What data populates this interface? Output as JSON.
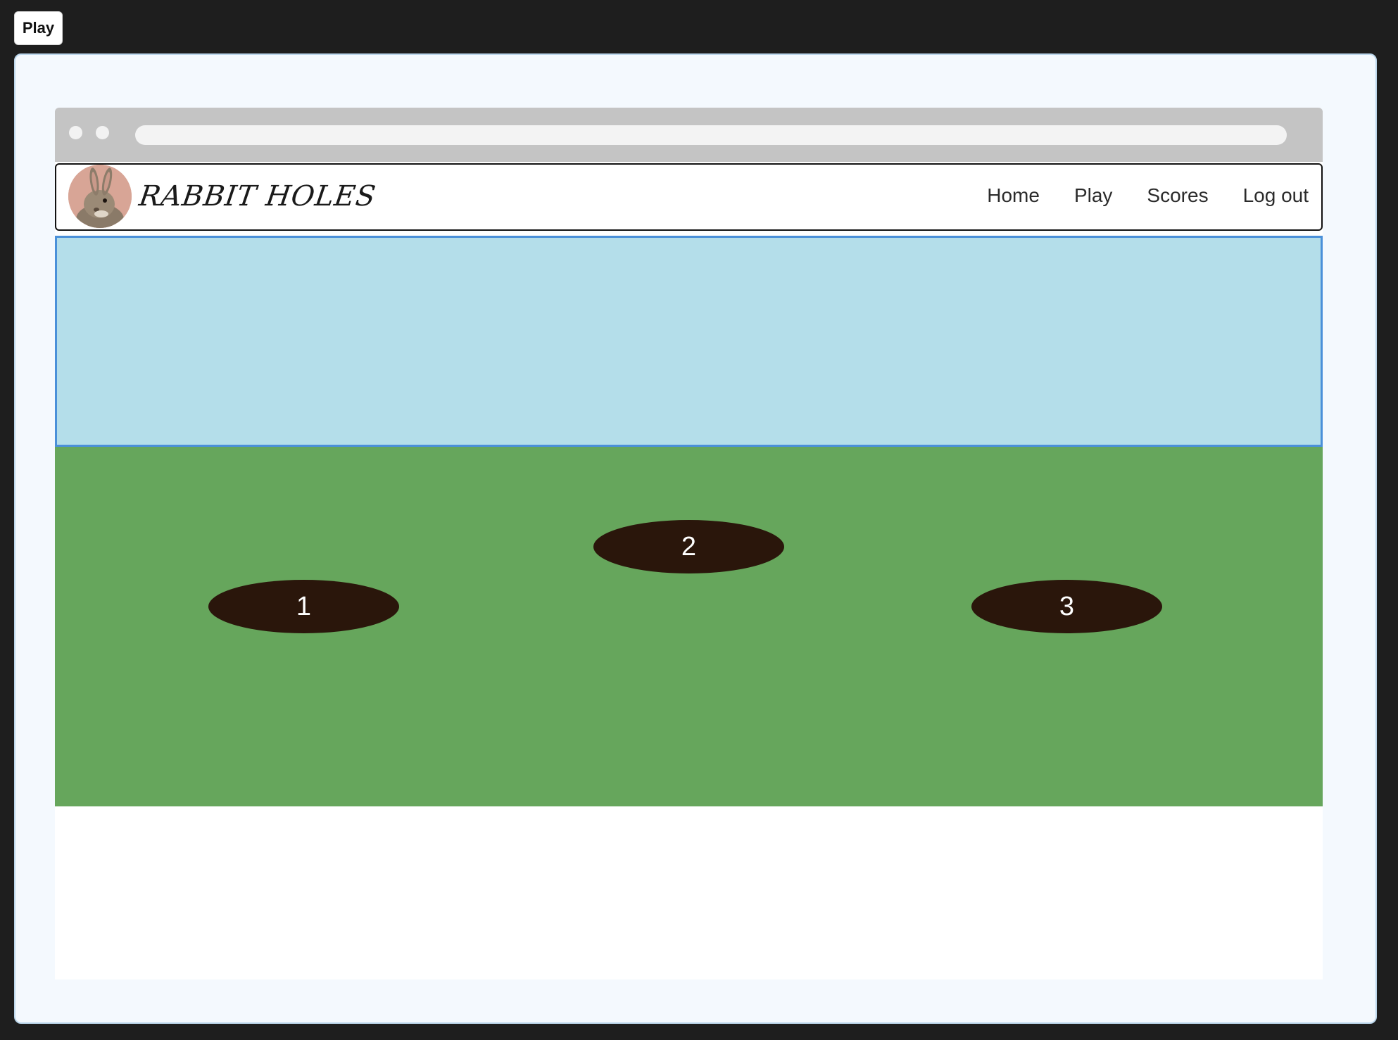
{
  "top_tab": {
    "label": "Play"
  },
  "app": {
    "brand": "RABBIT HOLES"
  },
  "nav": {
    "items": [
      {
        "label": "Home"
      },
      {
        "label": "Play"
      },
      {
        "label": "Scores"
      },
      {
        "label": "Log out"
      }
    ]
  },
  "game": {
    "holes": [
      {
        "label": "1"
      },
      {
        "label": "2"
      },
      {
        "label": "3"
      }
    ]
  },
  "colors": {
    "sky": "#b4deea",
    "sky_border": "#4a90d9",
    "grass": "#66a65c",
    "hole": "#2a160b"
  },
  "icons": {
    "logo": "rabbit-avatar-icon"
  }
}
